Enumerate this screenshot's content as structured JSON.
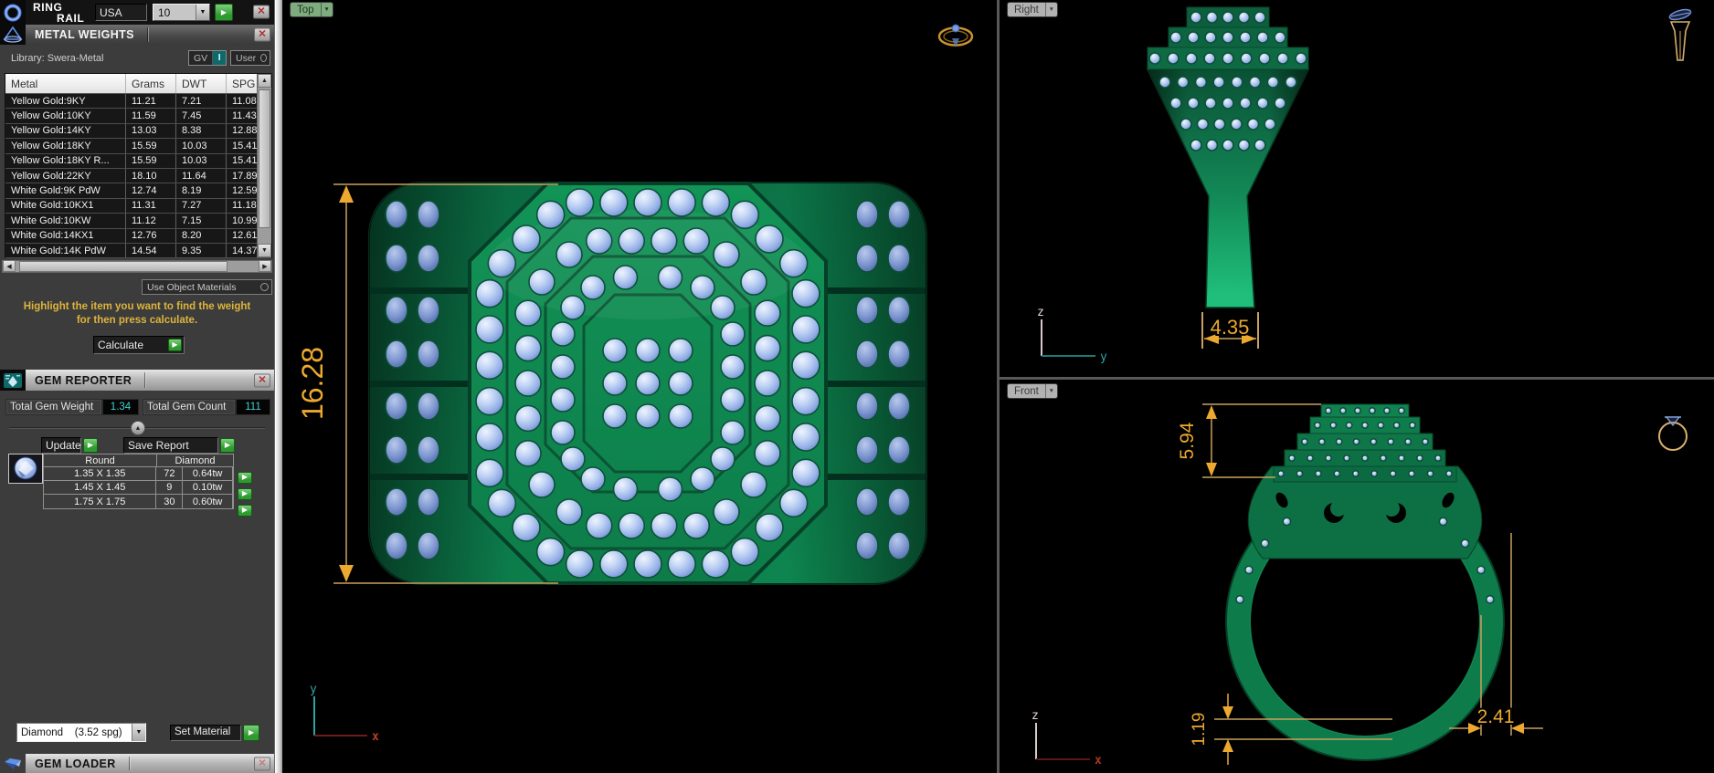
{
  "ring_rail": {
    "line1": "RING",
    "line2": "RAIL",
    "region_value": "USA",
    "size_value": "10"
  },
  "metal_weights": {
    "title": "METAL WEIGHTS",
    "library_label": "Library: Swera-Metal",
    "gv_label": "GV",
    "gv_state": "I",
    "user_label": "User",
    "table": {
      "headers": [
        "Metal",
        "Grams",
        "DWT",
        "SPG"
      ],
      "rows": [
        [
          "Yellow Gold:9KY",
          "11.21",
          "7.21",
          "11.08"
        ],
        [
          "Yellow Gold:10KY",
          "11.59",
          "7.45",
          "11.43"
        ],
        [
          "Yellow Gold:14KY",
          "13.03",
          "8.38",
          "12.88"
        ],
        [
          "Yellow Gold:18KY",
          "15.59",
          "10.03",
          "15.41"
        ],
        [
          "Yellow Gold:18KY R...",
          "15.59",
          "10.03",
          "15.41"
        ],
        [
          "Yellow Gold:22KY",
          "18.10",
          "11.64",
          "17.89"
        ],
        [
          "White Gold:9K PdW",
          "12.74",
          "8.19",
          "12.59"
        ],
        [
          "White Gold:10KX1",
          "11.31",
          "7.27",
          "11.18"
        ],
        [
          "White Gold:10KW",
          "11.12",
          "7.15",
          "10.99"
        ],
        [
          "White Gold:14KX1",
          "12.76",
          "8.20",
          "12.61"
        ],
        [
          "White Gold:14K PdW",
          "14.54",
          "9.35",
          "14.37"
        ]
      ]
    },
    "use_object_materials": "Use Object Materials",
    "instruction_line1": "Highlight the item you want to find the weight",
    "instruction_line2": "for then press calculate.",
    "calculate_label": "Calculate"
  },
  "gem_reporter": {
    "title": "GEM REPORTER",
    "total_weight_label": "Total Gem Weight",
    "total_weight_value": "1.34",
    "total_count_label": "Total Gem Count",
    "total_count_value": "111",
    "update_label": "Update",
    "save_report_label": "Save Report",
    "gem_table": {
      "shape_header": "Round",
      "material_header": "Diamond",
      "rows": [
        {
          "size": "1.35 X 1.35",
          "count": "72",
          "weight": "0.64tw"
        },
        {
          "size": "1.45 X 1.45",
          "count": "9",
          "weight": "0.10tw"
        },
        {
          "size": "1.75 X 1.75",
          "count": "30",
          "weight": "0.60tw"
        }
      ]
    },
    "material_select": "Diamond    (3.52 spg)",
    "set_material_label": "Set Material"
  },
  "gem_loader": {
    "title": "GEM LOADER"
  },
  "viewports": {
    "top": {
      "label": "Top",
      "dimension": "16.28",
      "axis_v": "y",
      "axis_h": "x"
    },
    "right": {
      "label": "Right",
      "dimension": "4.35",
      "axis_v": "z",
      "axis_h": "y"
    },
    "front": {
      "label": "Front",
      "dim_height": "5.94",
      "dim_rail": "1.19",
      "dim_width": "2.41",
      "axis_v": "z",
      "axis_h": "x"
    }
  },
  "colors": {
    "accent_teal": "#3fd0c9",
    "dimension_orange": "#eda92f",
    "instruction_yellow": "#ddb43b",
    "ring_green": "#0f8a52",
    "gem_blue": "#a9c0ee",
    "play_green": "#3da53d",
    "close_red": "#b03030"
  }
}
